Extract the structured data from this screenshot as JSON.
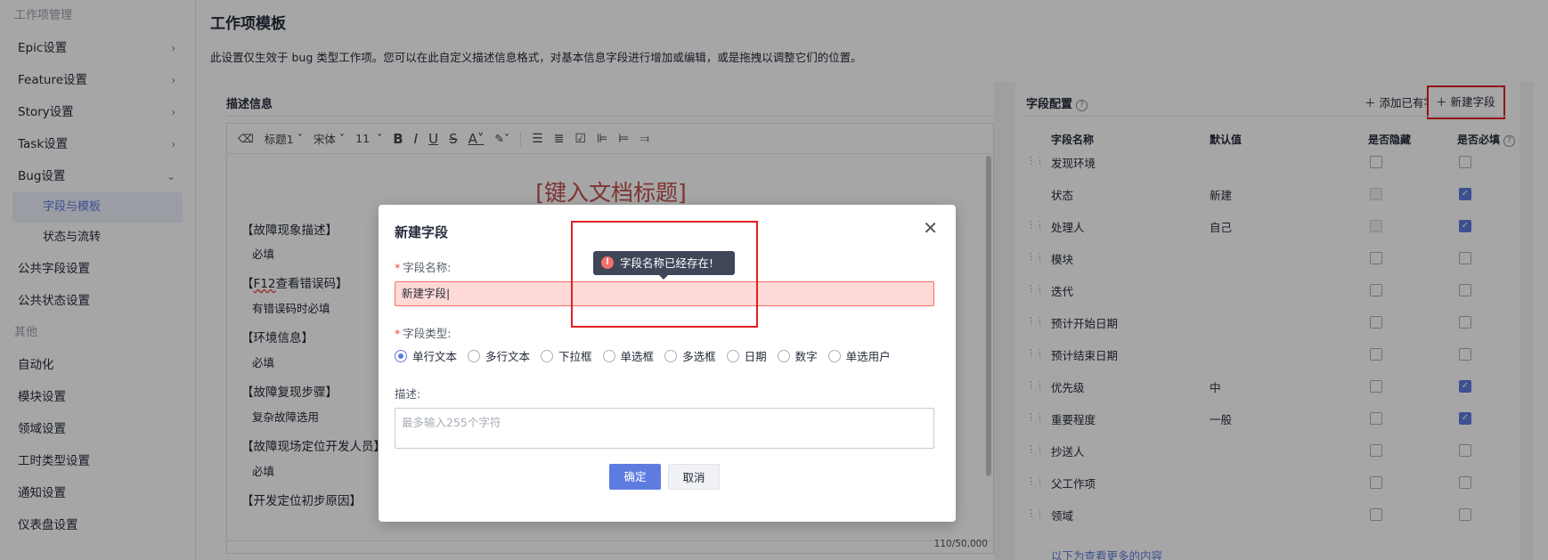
{
  "sidebar": {
    "group_work": "工作项管理",
    "items": [
      {
        "label": "Epic设置",
        "chev": "›"
      },
      {
        "label": "Feature设置",
        "chev": "›"
      },
      {
        "label": "Story设置",
        "chev": "›"
      },
      {
        "label": "Task设置",
        "chev": "›"
      },
      {
        "label": "Bug设置",
        "chev": "⌄"
      }
    ],
    "bug_sub": [
      {
        "label": "字段与模板"
      },
      {
        "label": "状态与流转"
      }
    ],
    "common_items": [
      "公共字段设置",
      "公共状态设置"
    ],
    "group_other": "其他",
    "other_items": [
      "自动化",
      "模块设置",
      "领域设置",
      "工时类型设置",
      "通知设置",
      "仪表盘设置"
    ]
  },
  "page": {
    "title": "工作项模板",
    "desc": "此设置仅生效于 bug 类型工作项。您可以在此自定义描述信息格式，对基本信息字段进行增加或编辑，或是拖拽以调整它们的位置。"
  },
  "editor": {
    "section_title": "描述信息",
    "toolbar": {
      "heading": "标题1",
      "font": "宋体",
      "size": "11"
    },
    "doc_title": "[键入文档标题]",
    "lines": [
      {
        "head": "【故障现象描述】",
        "sub": "必填"
      },
      {
        "head_pre": "【",
        "head_wavy": "F12",
        "head_post": "查看错误码】",
        "sub": "有错误码时必填"
      },
      {
        "head": "【环境信息】",
        "sub": "必填"
      },
      {
        "head": "【故障复现步骤】",
        "sub": "复杂故障选用"
      },
      {
        "head": "【故障现场定位开发人员】",
        "sub": "必填"
      },
      {
        "head": "【开发定位初步原因】"
      }
    ],
    "counter": "110/50,000"
  },
  "config": {
    "title": "字段配置",
    "add_existing": "添加已有字段",
    "new_field": "新建字段",
    "headers": {
      "name": "字段名称",
      "default": "默认值",
      "hidden": "是否隐藏",
      "required": "是否必填"
    },
    "rows": [
      {
        "name": "发现环境",
        "default": "",
        "drag": true,
        "hidden": "off",
        "required": "off"
      },
      {
        "name": "状态",
        "default": "新建",
        "drag": false,
        "hidden": "disabled",
        "required": "checked"
      },
      {
        "name": "处理人",
        "default": "自己",
        "drag": true,
        "hidden": "disabled",
        "required": "checked"
      },
      {
        "name": "模块",
        "default": "",
        "drag": true,
        "hidden": "off",
        "required": "off"
      },
      {
        "name": "迭代",
        "default": "",
        "drag": true,
        "hidden": "off",
        "required": "off"
      },
      {
        "name": "预计开始日期",
        "default": "",
        "drag": true,
        "hidden": "off",
        "required": "off"
      },
      {
        "name": "预计结束日期",
        "default": "",
        "drag": true,
        "hidden": "off",
        "required": "off"
      },
      {
        "name": "优先级",
        "default": "中",
        "drag": true,
        "hidden": "off",
        "required": "checked"
      },
      {
        "name": "重要程度",
        "default": "一般",
        "drag": true,
        "hidden": "off",
        "required": "checked"
      },
      {
        "name": "抄送人",
        "default": "",
        "drag": true,
        "hidden": "off",
        "required": "off"
      },
      {
        "name": "父工作项",
        "default": "",
        "drag": true,
        "hidden": "off",
        "required": "off"
      },
      {
        "name": "领域",
        "default": "",
        "drag": true,
        "hidden": "off",
        "required": "off"
      }
    ],
    "more": "以下为查看更多的内容"
  },
  "dialog": {
    "title": "新建字段",
    "name_label": "字段名称:",
    "name_value": "新建字段",
    "error_tip": "字段名称已经存在!",
    "type_label": "字段类型:",
    "types": [
      "单行文本",
      "多行文本",
      "下拉框",
      "单选框",
      "多选框",
      "日期",
      "数字",
      "单选用户"
    ],
    "selected_type": "单行文本",
    "desc_label": "描述:",
    "desc_placeholder": "最多输入255个字符",
    "ok": "确定",
    "cancel": "取消"
  },
  "colors": {
    "accent": "#5e7ce0",
    "error": "#f66f6a",
    "highlight_box": "#e02020"
  }
}
